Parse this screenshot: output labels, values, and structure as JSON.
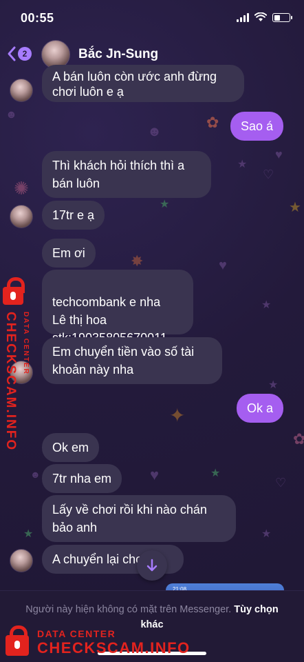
{
  "status_bar": {
    "time": "00:55"
  },
  "header": {
    "back_count": "2",
    "contact_name": "Bắc Jn-Sung"
  },
  "messages": [
    {
      "text": "A bán luôn còn ước anh đừng\nchơi luôn e ạ"
    },
    {
      "text": "Sao á"
    },
    {
      "text": "Thì khách hỏi thích thì a\nbán luôn"
    },
    {
      "text": "17tr e ạ"
    },
    {
      "text": "Em ơi"
    },
    {
      "text_before": "techcombank e nha\nLê thị hoa\nstk:",
      "account_number": "19035805670011"
    },
    {
      "text": "Em chuyển tiền vào số tài\nkhoản này nha"
    },
    {
      "text": "Ok a"
    },
    {
      "text": "Ok em"
    },
    {
      "text": "7tr nha em"
    },
    {
      "text": "Lấy về chơi rồi khi nào chán\nbảo anh"
    },
    {
      "text": "A chuyển lại cho 7tr"
    }
  ],
  "attachment_thumb": {
    "time": "21:08"
  },
  "footer": {
    "notice": "Người này hiện không có mặt trên Messenger.",
    "options_link": "Tùy chọn khác"
  },
  "watermark": {
    "sub": "DATA CENTER",
    "main": "CHECKSCAM.INFO",
    "color": "#e3231e"
  },
  "theme": {
    "sent_bubble": "#a55ef0",
    "received_bubble": "#3a3450",
    "accent": "#a77cff",
    "background": "#241a3c"
  }
}
